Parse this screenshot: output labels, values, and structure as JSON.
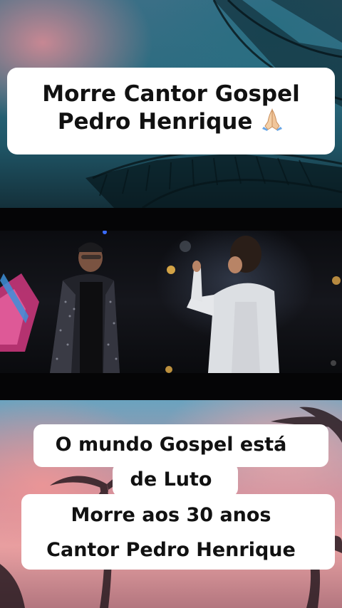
{
  "top_caption": {
    "line1": "Morre Cantor Gospel",
    "line2": "Pedro Henrique",
    "emoji": "folded-hands-icon"
  },
  "bottom_caption": {
    "line1": "O mundo Gospel está",
    "line2": "de Luto",
    "line3": "Morre aos 30 anos",
    "line4": "Cantor Pedro Henrique"
  },
  "colors": {
    "caption_bg": "#ffffff",
    "caption_text": "#111111",
    "video_bg": "#050506"
  }
}
